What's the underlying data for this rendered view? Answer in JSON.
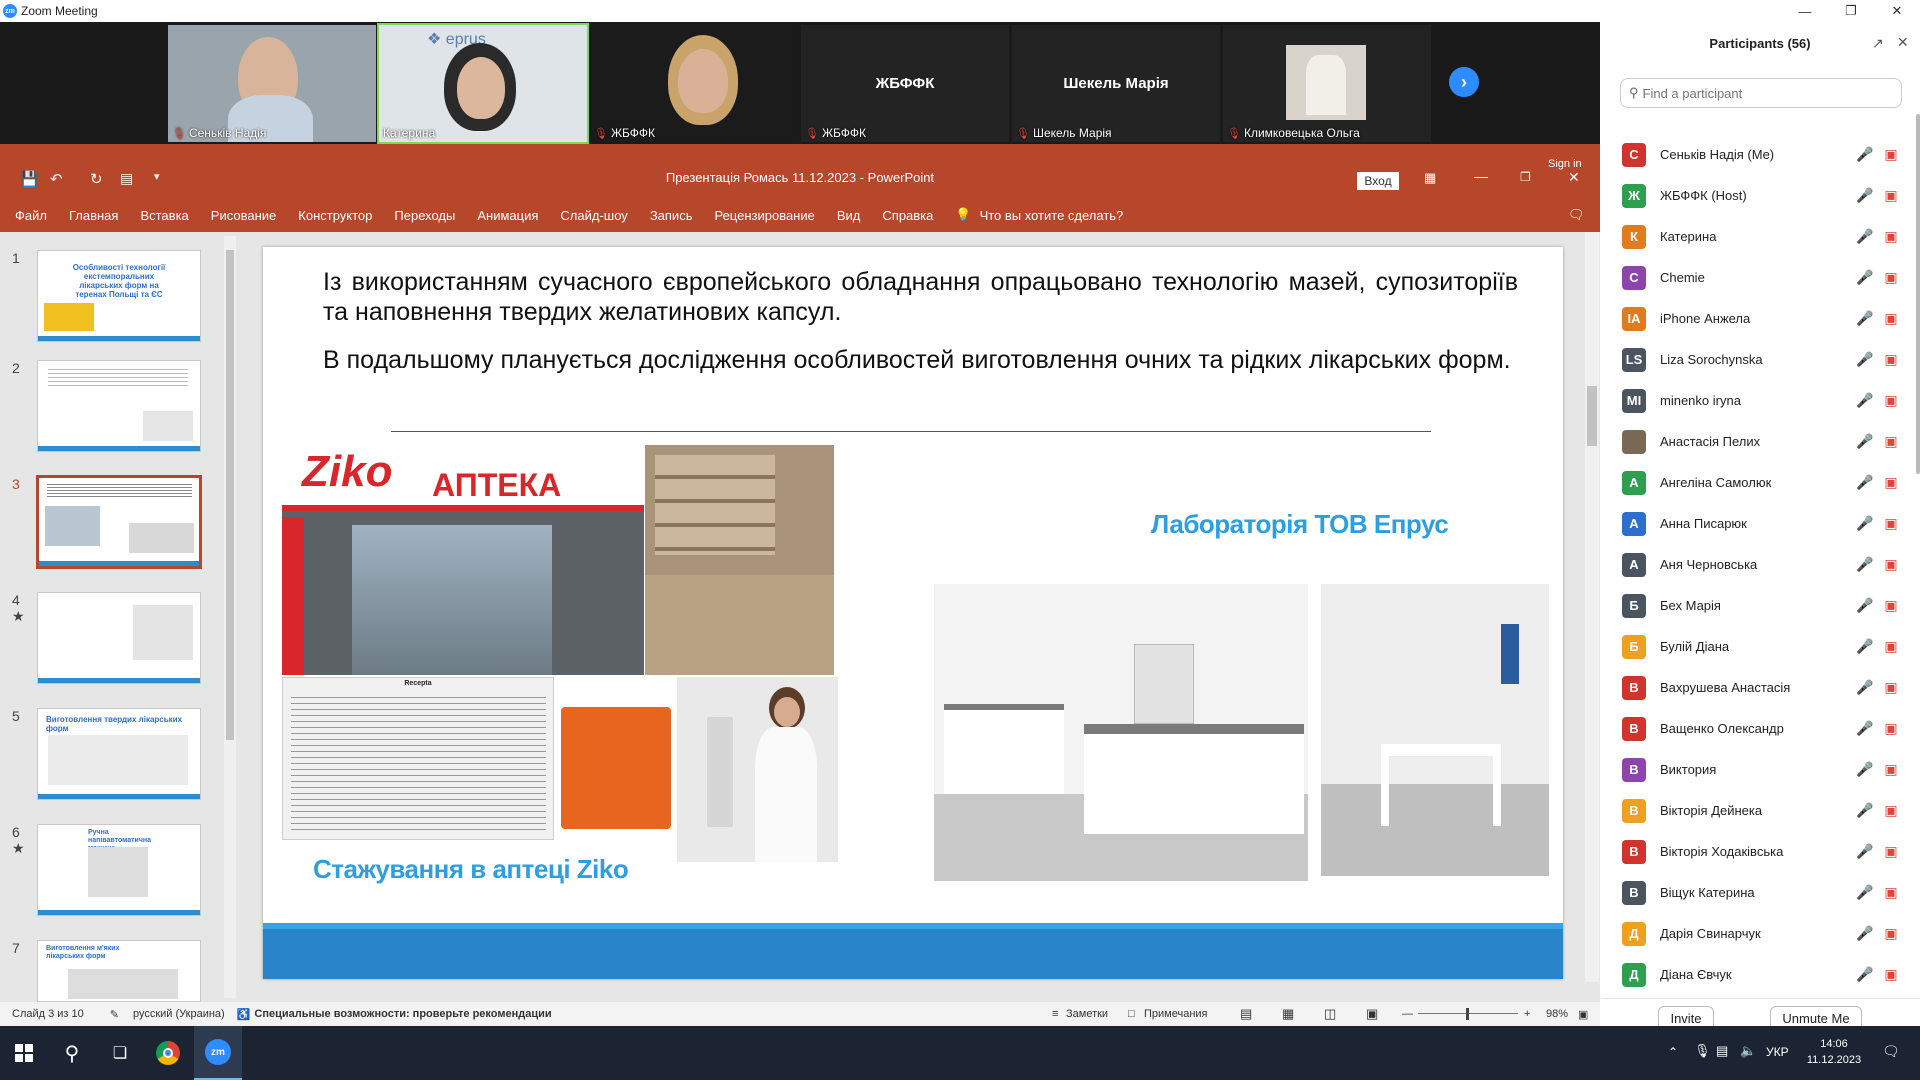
{
  "zoom": {
    "window_title": "Zoom Meeting",
    "logo_text": "zm",
    "tiles": [
      {
        "name": "Сеньків Надія",
        "video": true
      },
      {
        "name": "Катерина",
        "video": true,
        "active_speaker": true
      },
      {
        "name": "ЖБФФК",
        "video": true
      },
      {
        "name": "ЖБФФК",
        "center_label": "ЖБФФК",
        "video": false
      },
      {
        "name": "Шекель Марія",
        "center_label": "Шекель Марія",
        "video": false
      },
      {
        "name": "Климковецька Ольга",
        "video": false,
        "avatar_photo": true
      }
    ]
  },
  "ppt": {
    "title": "Презентація Ромась 11.12.2023  -  PowerPoint",
    "login_btn": "Вход",
    "sign_in": "Sign in",
    "tabs": [
      "Файл",
      "Главная",
      "Вставка",
      "Рисование",
      "Конструктор",
      "Переходы",
      "Анимация",
      "Слайд-шоу",
      "Запись",
      "Рецензирование",
      "Вид",
      "Справка"
    ],
    "tell_me": "Что вы хотите сделать?",
    "thumbnails": [
      {
        "num": "1",
        "star": false,
        "title": "Особливості технології екстемпоральних лікарських форм на теренах Польщі та ЄС"
      },
      {
        "num": "2",
        "star": false,
        "title": ""
      },
      {
        "num": "3",
        "star": false,
        "selected": true,
        "title": ""
      },
      {
        "num": "4",
        "star": true,
        "title": ""
      },
      {
        "num": "5",
        "star": false,
        "title": "Виготовлення твердих лікарських форм"
      },
      {
        "num": "6",
        "star": true,
        "title": "Ручна напівавтоматична машина"
      },
      {
        "num": "7",
        "star": false,
        "title": "Виготовлення м'яких лікарських форм"
      }
    ],
    "slide": {
      "para1": "Із використанням сучасного європейського обладнання опрацьовано технологію мазей, супозиторіїв та наповнення твердих желатинових капсул.",
      "para2": "В подальшому планується дослідження особливостей виготовлення очних та  рідких лікарських форм.",
      "store_sign_big": "Ziko",
      "store_sign_small": "АПТЕКА",
      "recipe_header": "Recepta",
      "caption_left": "Стажування в аптеці Ziko",
      "caption_right": "Лабораторія ТОВ Епрус"
    },
    "status": {
      "slide_pos": "Слайд 3 из 10",
      "language": "русский (Украина)",
      "accessibility": "Специальные возможности: проверьте рекомендации",
      "notes": "Заметки",
      "comments": "Примечания",
      "zoom": "98%"
    }
  },
  "participants": {
    "title": "Participants (56)",
    "search_placeholder": "Find a participant",
    "list": [
      {
        "initial": "С",
        "name": "Сеньків Надія (Me)",
        "color": "#d0342c"
      },
      {
        "initial": "Ж",
        "name": "ЖБФФК (Host)",
        "color": "#2e9e4f"
      },
      {
        "initial": "К",
        "name": "Катерина",
        "color": "#e07b1f"
      },
      {
        "initial": "C",
        "name": "Chemie",
        "color": "#8e44ad"
      },
      {
        "initial": "IA",
        "name": "iPhone Анжела",
        "color": "#e07b1f"
      },
      {
        "initial": "LS",
        "name": "Liza Sorochynska",
        "color": "#4a5560"
      },
      {
        "initial": "MI",
        "name": "minenko iryna",
        "color": "#4a5560"
      },
      {
        "initial": "",
        "name": "Анастасія Пелих",
        "color": "#7a6a55"
      },
      {
        "initial": "А",
        "name": "Ангеліна Самолюк",
        "color": "#2e9e4f"
      },
      {
        "initial": "А",
        "name": "Анна Писарюк",
        "color": "#2d6fcf"
      },
      {
        "initial": "А",
        "name": "Аня Черновська",
        "color": "#4a5560"
      },
      {
        "initial": "Б",
        "name": "Бех Марія",
        "color": "#4a5560"
      },
      {
        "initial": "Б",
        "name": "Булій Діана",
        "color": "#f0a020"
      },
      {
        "initial": "В",
        "name": "Вахрушева Анастасія",
        "color": "#d0342c"
      },
      {
        "initial": "В",
        "name": "Ващенко Олександр",
        "color": "#d0342c"
      },
      {
        "initial": "В",
        "name": "Виктория",
        "color": "#8e44ad"
      },
      {
        "initial": "В",
        "name": "Вікторія Дейнека",
        "color": "#f0a020"
      },
      {
        "initial": "В",
        "name": "Вікторія Ходаківська",
        "color": "#d0342c"
      },
      {
        "initial": "В",
        "name": "Віщук Катерина",
        "color": "#4a5560"
      },
      {
        "initial": "Д",
        "name": "Дарія Свинарчук",
        "color": "#f0a020"
      },
      {
        "initial": "Д",
        "name": "Діана Євчук",
        "color": "#2e9e4f"
      }
    ],
    "invite_btn": "Invite",
    "unmute_btn": "Unmute Me"
  },
  "taskbar": {
    "lang": "УКР",
    "time": "14:06",
    "date": "11.12.2023"
  }
}
